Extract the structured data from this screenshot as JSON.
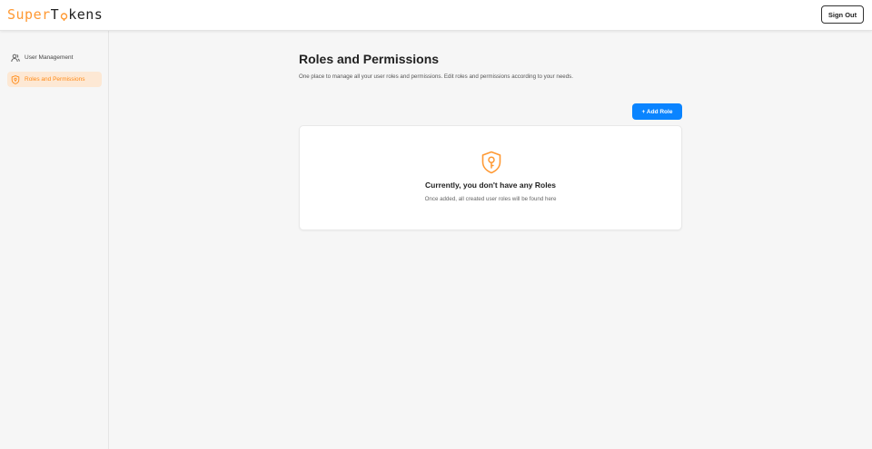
{
  "header": {
    "logo_super": "Super",
    "logo_tokens": "kens",
    "logo_t": "T",
    "sign_out_label": "Sign Out"
  },
  "sidebar": {
    "items": [
      {
        "label": "User Management",
        "icon": "users-icon",
        "active": false
      },
      {
        "label": "Roles and Permissions",
        "icon": "shield-icon",
        "active": true
      }
    ]
  },
  "main": {
    "title": "Roles and Permissions",
    "description": "One place to manage all your user roles and permissions. Edit roles and permissions according to your needs.",
    "add_role_label": "+ Add Role",
    "empty_state": {
      "icon": "shield-key-icon",
      "title": "Currently, you don't have any Roles",
      "subtitle": "Once added, all created user roles will be found here"
    }
  },
  "colors": {
    "accent": "#ff9933",
    "primary_button": "#0a84ff",
    "active_bg": "#fde8d4"
  }
}
